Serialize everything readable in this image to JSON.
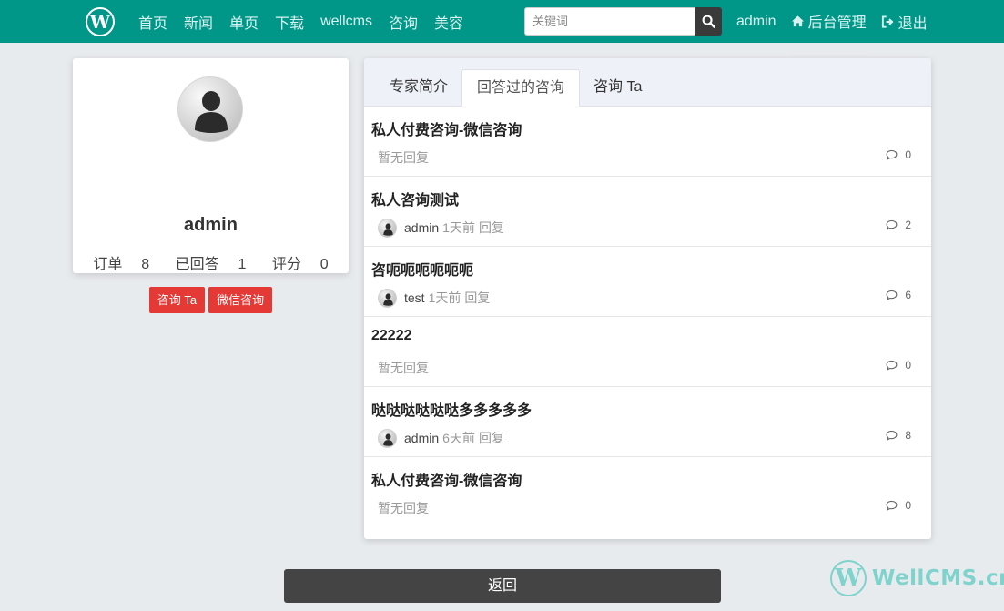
{
  "navbar": {
    "logo": "W",
    "links": [
      "首页",
      "新闻",
      "单页",
      "下载",
      "wellcms",
      "咨询",
      "美容"
    ],
    "search_placeholder": "关键词",
    "username": "admin",
    "admin_label": "后台管理",
    "logout_label": "退出"
  },
  "profile": {
    "name": "admin",
    "stats": [
      {
        "label": "订单",
        "value": "8"
      },
      {
        "label": "已回答",
        "value": "1"
      },
      {
        "label": "评分",
        "value": "0"
      }
    ],
    "consult_button": "咨询 Ta",
    "wechat_button": "微信咨询"
  },
  "tabs": [
    "专家简介",
    "回答过的咨询",
    "咨询 Ta"
  ],
  "active_tab": 1,
  "items": [
    {
      "title": "私人付费咨询-微信咨询",
      "user": "",
      "time": "",
      "reply": "",
      "none": "暂无回复",
      "count": "0"
    },
    {
      "title": "私人咨询测试",
      "user": "admin",
      "time": "1天前",
      "reply": "回复",
      "none": "",
      "count": "2"
    },
    {
      "title": "咨呃呃呃呃呃呃",
      "user": "test",
      "time": "1天前",
      "reply": "回复",
      "none": "",
      "count": "6"
    },
    {
      "title": "22222",
      "user": "",
      "time": "",
      "reply": "",
      "none": "暂无回复",
      "count": "0"
    },
    {
      "title": "哒哒哒哒哒哒多多多多多",
      "user": "admin",
      "time": "6天前",
      "reply": "回复",
      "none": "",
      "count": "8"
    },
    {
      "title": "私人付费咨询-微信咨询",
      "user": "",
      "time": "",
      "reply": "",
      "none": "暂无回复",
      "count": "0"
    }
  ],
  "back_button": "返回",
  "watermark": {
    "logo": "W",
    "text": "WellCMS.cn"
  }
}
